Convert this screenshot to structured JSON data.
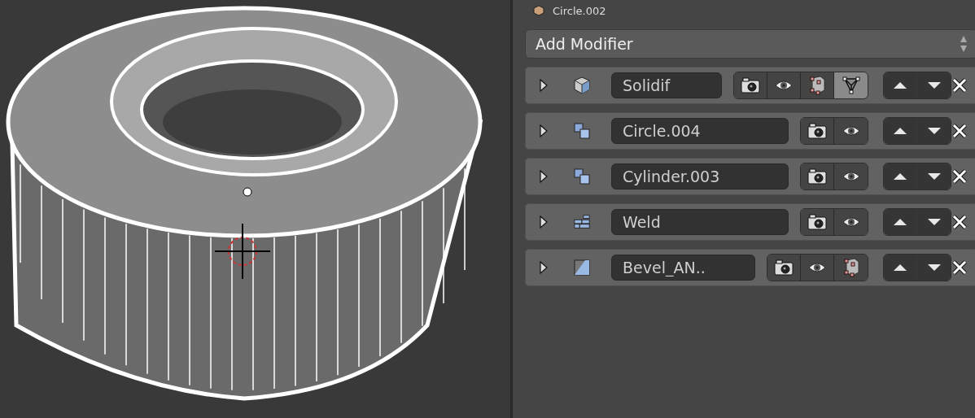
{
  "header": {
    "object_name": "Circle.002"
  },
  "add_modifier": {
    "label": "Add Modifier"
  },
  "modifiers": [
    {
      "kind": "solidify",
      "name": "Solidif",
      "expanded": false,
      "toggles": [
        {
          "kind": "render",
          "on": false
        },
        {
          "kind": "realtime",
          "on": false
        },
        {
          "kind": "editmode",
          "on": false
        },
        {
          "kind": "cage",
          "on": true
        }
      ]
    },
    {
      "kind": "boolean",
      "name": "Circle.004",
      "expanded": false,
      "toggles": [
        {
          "kind": "render",
          "on": false
        },
        {
          "kind": "realtime",
          "on": false
        }
      ]
    },
    {
      "kind": "boolean",
      "name": "Cylinder.003",
      "expanded": false,
      "toggles": [
        {
          "kind": "render",
          "on": false
        },
        {
          "kind": "realtime",
          "on": false
        }
      ]
    },
    {
      "kind": "weld",
      "name": "Weld",
      "expanded": false,
      "toggles": [
        {
          "kind": "render",
          "on": false
        },
        {
          "kind": "realtime",
          "on": false
        }
      ]
    },
    {
      "kind": "bevel",
      "name": "Bevel_AN..",
      "expanded": false,
      "toggles": [
        {
          "kind": "render",
          "on": false
        },
        {
          "kind": "realtime",
          "on": false
        },
        {
          "kind": "editmode",
          "on": false
        }
      ]
    }
  ]
}
